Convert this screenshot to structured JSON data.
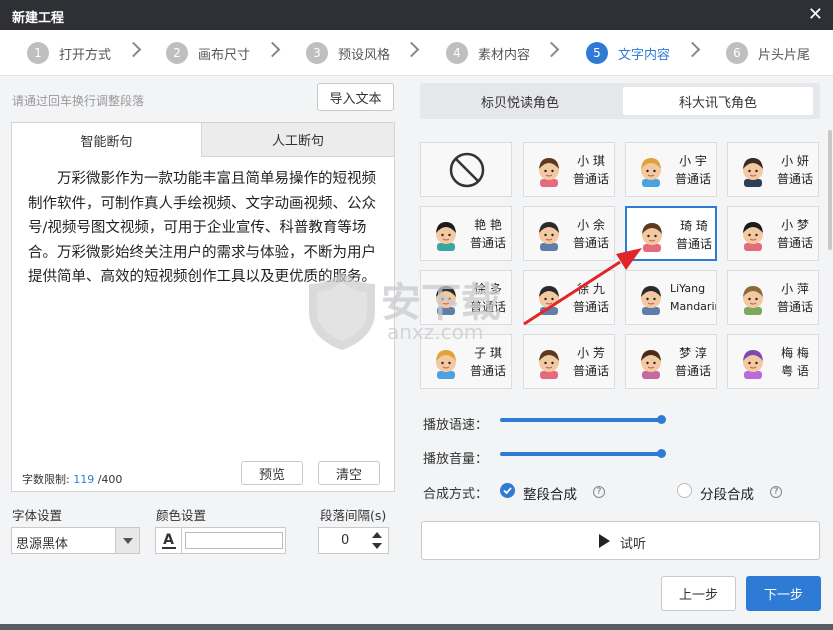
{
  "window": {
    "title": "新建工程"
  },
  "steps": [
    {
      "num": "1",
      "label": "打开方式"
    },
    {
      "num": "2",
      "label": "画布尺寸"
    },
    {
      "num": "3",
      "label": "预设风格"
    },
    {
      "num": "4",
      "label": "素材内容"
    },
    {
      "num": "5",
      "label": "文字内容",
      "active": true
    },
    {
      "num": "6",
      "label": "片头片尾"
    }
  ],
  "left": {
    "hint": "请通过回车换行调整段落",
    "import_label": "导入文本",
    "tabs": [
      "智能断句",
      "人工断句"
    ],
    "text": "万彩微影作为一款功能丰富且简单易操作的短视频制作软件，可制作真人手绘视频、文字动画视频、公众号/视频号图文视频，可用于企业宣传、科普教育等场合。万彩微影始终关注用户的需求与体验，不断为用户提供简单、高效的短视频创作工具以及更优质的服务。",
    "limit_label": "字数限制:",
    "limit_current": "119",
    "limit_max": "/400",
    "preview_label": "预览",
    "clear_label": "清空",
    "font_label": "字体设置",
    "font_value": "思源黑体",
    "color_label": "颜色设置",
    "color_icon": "A",
    "spacing_label": "段落间隔(s)",
    "spacing_value": "0"
  },
  "right": {
    "roles": [
      "标贝悦读角色",
      "科大讯飞角色"
    ],
    "active_role": 1,
    "voices": [
      {
        "name": "",
        "type": "",
        "icon": "none-icon"
      },
      {
        "name": "小 琪",
        "type": "普通话",
        "icon": "girl-avatar-icon"
      },
      {
        "name": "小 宇",
        "type": "普通话",
        "icon": "boy-avatar-icon"
      },
      {
        "name": "小 妍",
        "type": "普通话",
        "icon": "man-suit-avatar-icon"
      },
      {
        "name": "艳 艳",
        "type": "普通话",
        "icon": "woman-headset-avatar-icon"
      },
      {
        "name": "小 余",
        "type": "普通话",
        "icon": "man-avatar-icon"
      },
      {
        "name": "琦 琦",
        "type": "普通话",
        "icon": "girl-avatar-icon",
        "selected": true
      },
      {
        "name": "小 梦",
        "type": "普通话",
        "icon": "girl-dark-avatar-icon"
      },
      {
        "name": "徐 多",
        "type": "普通话",
        "icon": "man-avatar-icon"
      },
      {
        "name": "徐 九",
        "type": "普通话",
        "icon": "man-avatar-icon"
      },
      {
        "name": "LiYang",
        "type": "Mandarin",
        "icon": "man-avatar-icon"
      },
      {
        "name": "小 萍",
        "type": "普通话",
        "icon": "woman-glasses-avatar-icon"
      },
      {
        "name": "子 琪",
        "type": "普通话",
        "icon": "boy-avatar-icon"
      },
      {
        "name": "小 芳",
        "type": "普通话",
        "icon": "girl-avatar-icon"
      },
      {
        "name": "梦 淳",
        "type": "普通话",
        "icon": "woman-avatar-icon"
      },
      {
        "name": "梅 梅",
        "type": "粤 语",
        "icon": "woman-purple-avatar-icon"
      }
    ],
    "speed_label": "播放语速：",
    "speed_value": 0.5,
    "volume_label": "播放音量：",
    "volume_value": 0.5,
    "mode_label": "合成方式：",
    "mode_options": [
      "整段合成",
      "分段合成"
    ],
    "mode_selected": 0,
    "help_glyph": "?",
    "play_label": "试听",
    "prev_label": "上一步",
    "next_label": "下一步"
  },
  "watermark": {
    "text": "安下载",
    "subtext": "anxz.com"
  },
  "colors": {
    "accent": "#2e7bd6",
    "titlebar": "#2f3035",
    "annotation_arrow": "#e0262a"
  }
}
